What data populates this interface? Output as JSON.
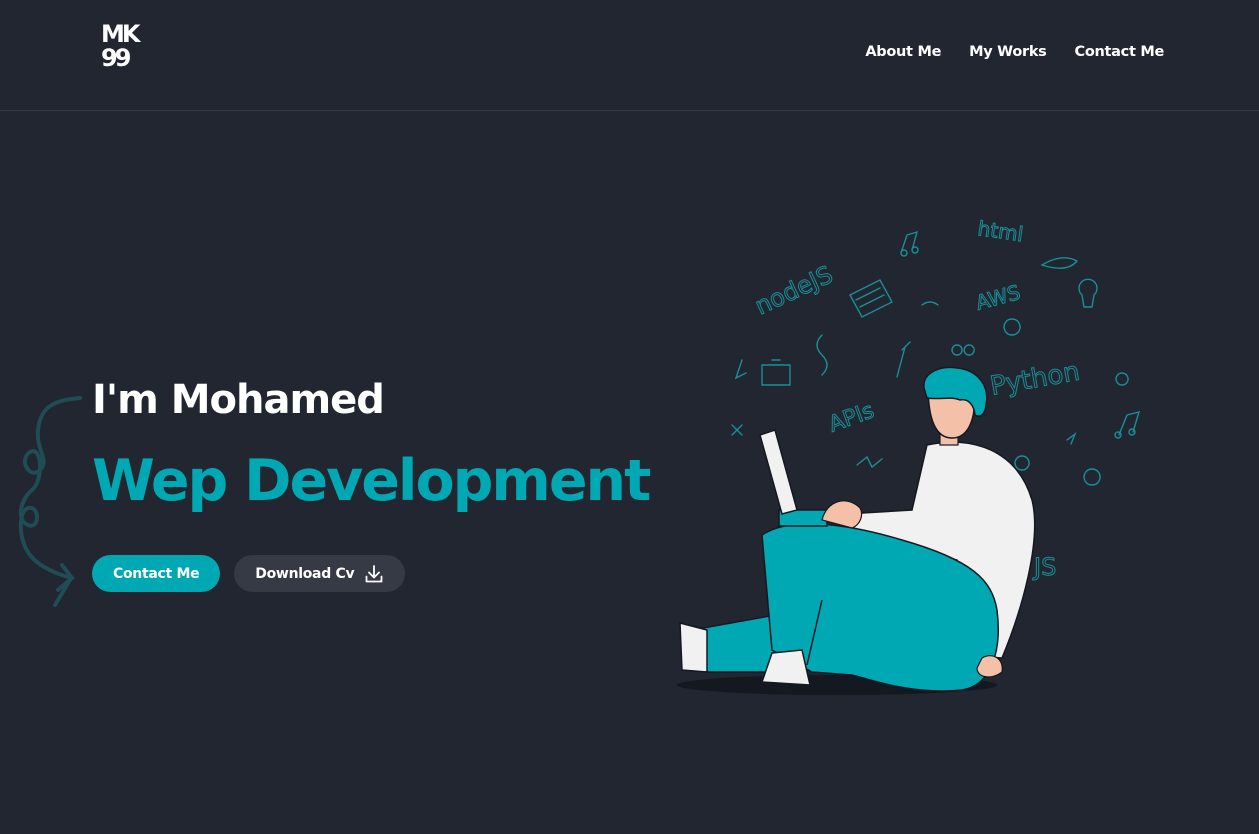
{
  "header": {
    "logo": {
      "line1": "MK",
      "line2": "99"
    },
    "nav": [
      {
        "label": "About Me"
      },
      {
        "label": "My Works"
      },
      {
        "label": "Contact Me"
      }
    ]
  },
  "hero": {
    "intro": "I'm Mohamed",
    "role": "Wep Development",
    "buttons": {
      "contact": "Contact Me",
      "download": "Download Cv"
    }
  },
  "illustration": {
    "doodle_words": [
      "nodeJS",
      "html",
      "AWS",
      "Python",
      "APIs",
      "JS"
    ]
  },
  "colors": {
    "background": "#212630",
    "accent": "#00a8b3",
    "secondary_button": "#353a45"
  },
  "icons": [
    "download-icon"
  ]
}
